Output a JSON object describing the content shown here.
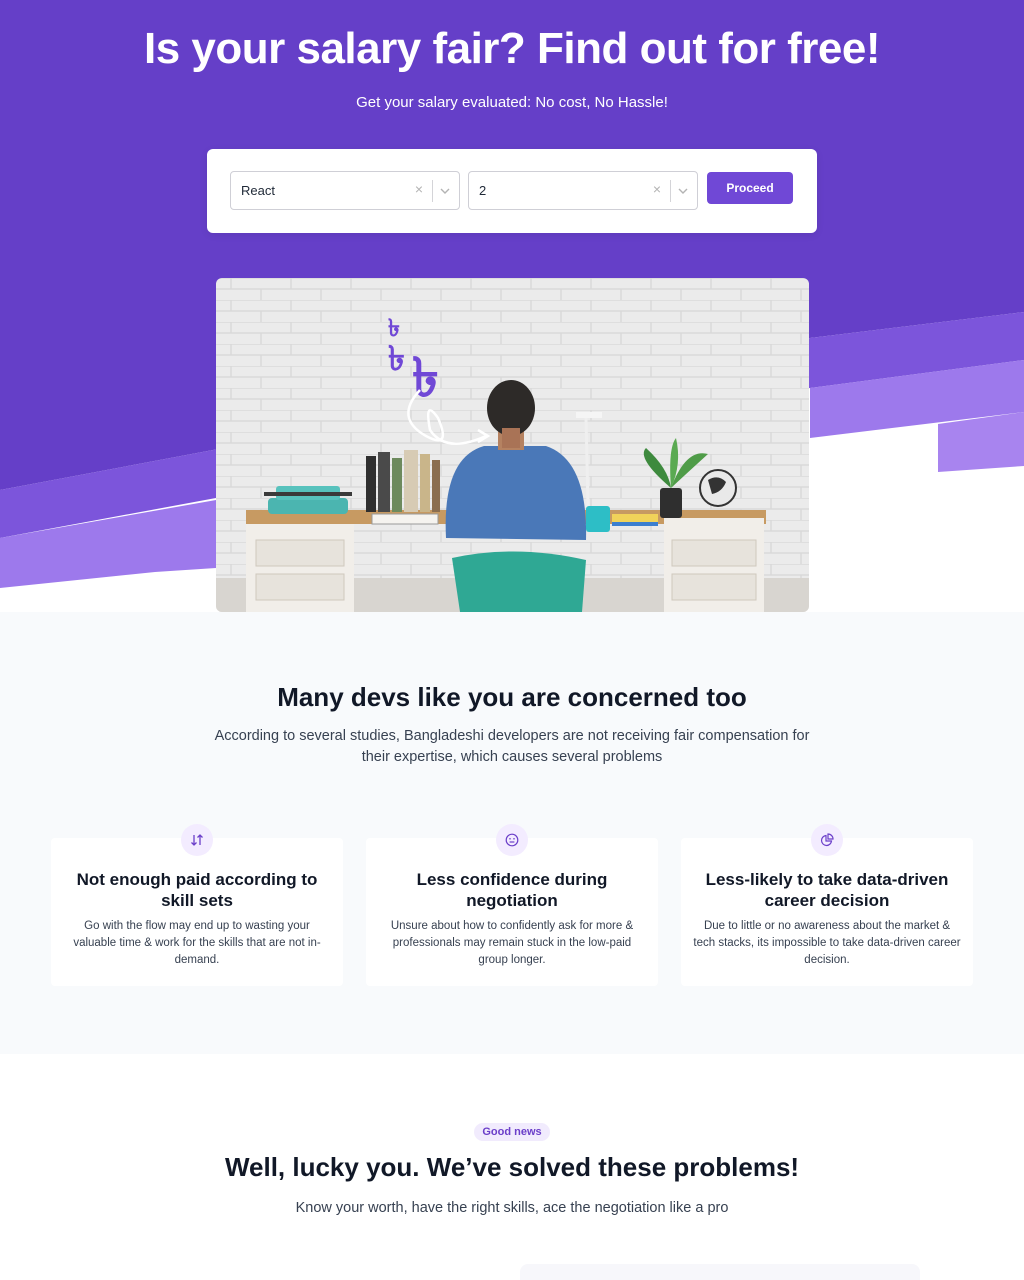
{
  "hero": {
    "title": "Is your salary fair? Find out for free!",
    "subtitle": "Get your salary evaluated: No cost, No Hassle!",
    "search": {
      "skill_value": "React",
      "experience_value": "2",
      "clear_glyph": "×",
      "proceed_label": "Proceed"
    },
    "photo_overlay_glyphs": [
      "৳",
      "৳",
      "৳"
    ]
  },
  "concerns": {
    "title": "Many devs like you are concerned too",
    "description": "According to several studies, Bangladeshi developers are not receiving fair compensation for their expertise, which causes several problems",
    "cards": [
      {
        "icon": "sort-descending-icon",
        "title": "Not enough paid according to skill sets",
        "description": "Go with the flow may end up to wasting your valuable time & work for the skills that are not in-demand."
      },
      {
        "icon": "neutral-face-icon",
        "title": "Less confidence during negotiation",
        "description": "Unsure about how to confidently ask for more & professionals may remain stuck in the low-paid group longer."
      },
      {
        "icon": "pie-chart-icon",
        "title": "Less-likely to take data-driven career decision",
        "description": "Due to little or no awareness about the market & tech stacks, its impossible to take data-driven career decision."
      }
    ]
  },
  "solved": {
    "badge": "Good news",
    "title": "Well, lucky you. We’ve solved these problems!",
    "subtitle": "Know your worth, have the right skills, ace the negotiation like a pro"
  },
  "colors": {
    "brand_purple": "#653fc8",
    "accent_purple": "#7048d6",
    "light_purple": "#9d79ec",
    "section_bg": "#f8fafc"
  }
}
